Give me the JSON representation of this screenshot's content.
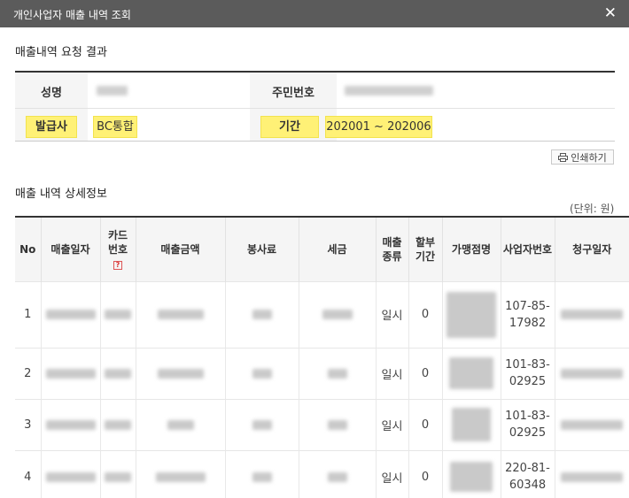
{
  "window": {
    "title": "개인사업자 매출 내역 조회",
    "close_label": "✕"
  },
  "request_result": {
    "heading": "매출내역 요청 결과",
    "name_label": "성명",
    "rrn_label": "주민번호",
    "issuer_label": "발급사",
    "issuer_value": "BC통합",
    "period_label": "기간",
    "period_value": "202001 ~ 202006"
  },
  "print_button": {
    "label": "인쇄하기"
  },
  "details": {
    "heading": "매출 내역 상세정보",
    "unit_note": "(단위: 원)",
    "columns": {
      "no": "No",
      "sale_date": "매출일자",
      "card_no_1": "카드",
      "card_no_2": "번호",
      "card_no_help": "?",
      "amount": "매출금액",
      "service_fee": "봉사료",
      "tax": "세금",
      "sale_type_1": "매출",
      "sale_type_2": "종류",
      "installment_1": "할부",
      "installment_2": "기간",
      "merchant": "가맹점명",
      "biz_no": "사업자번호",
      "claim_date": "청구일자"
    },
    "rows": [
      {
        "no": "1",
        "sale_type": "일시",
        "installment": "0",
        "biz_no_1": "107-85-",
        "biz_no_2": "17982"
      },
      {
        "no": "2",
        "sale_type": "일시",
        "installment": "0",
        "biz_no_1": "101-83-",
        "biz_no_2": "02925"
      },
      {
        "no": "3",
        "sale_type": "일시",
        "installment": "0",
        "biz_no_1": "101-83-",
        "biz_no_2": "02925"
      },
      {
        "no": "4",
        "sale_type": "일시",
        "installment": "0",
        "biz_no_1": "220-81-",
        "biz_no_2": "60348"
      }
    ]
  }
}
